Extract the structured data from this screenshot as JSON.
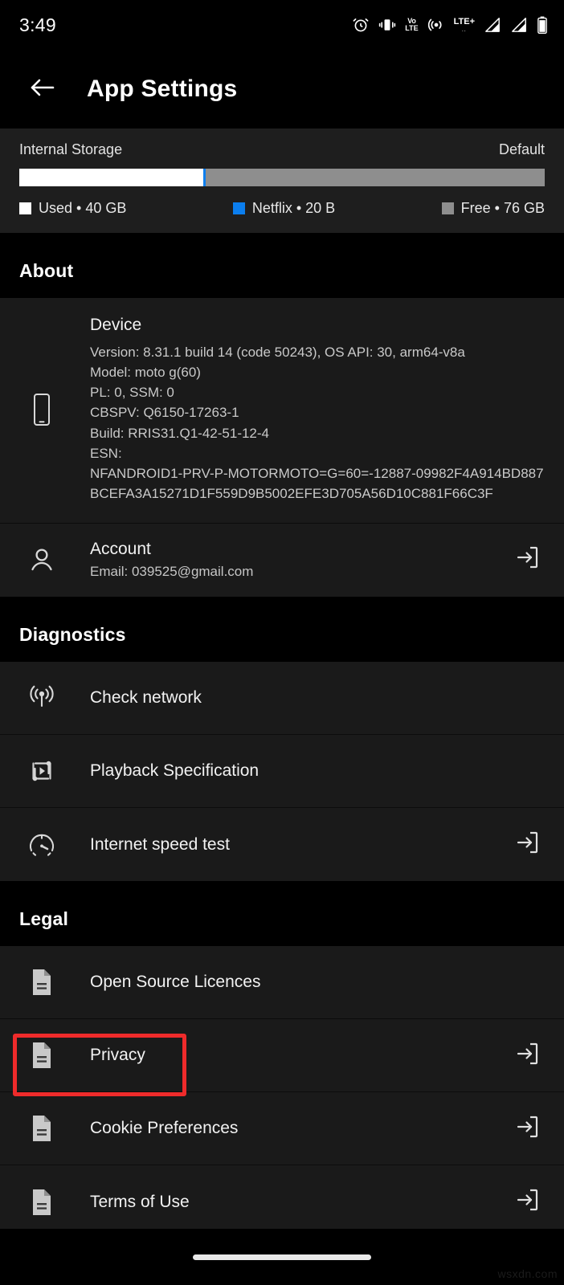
{
  "status_bar": {
    "time": "3:49",
    "icons": [
      "alarm-icon",
      "vibrate-icon",
      "volte-icon",
      "hotspot-icon",
      "lte-plus-icon",
      "signal-1-icon",
      "signal-2-icon",
      "battery-icon"
    ],
    "volte_top": "Vo",
    "volte_bottom": "LTE",
    "lte_label": "LTE+",
    "lte_dots": ".."
  },
  "app_bar": {
    "back_icon": "arrow-left-icon",
    "title": "App Settings"
  },
  "storage": {
    "label": "Internal Storage",
    "mode": "Default",
    "used_pct": 35,
    "netflix_pct": 0.4,
    "free_pct": 64.6,
    "colors": {
      "used": "#ffffff",
      "netflix": "#0b7eee",
      "free": "#8e8e8e"
    },
    "legend": [
      {
        "label": "Used • 40 GB",
        "color": "#ffffff"
      },
      {
        "label": "Netflix • 20 B",
        "color": "#0b7eee"
      },
      {
        "label": "Free • 76 GB",
        "color": "#8e8e8e"
      }
    ]
  },
  "about": {
    "header": "About",
    "device": {
      "icon": "smartphone-icon",
      "title": "Device",
      "lines": [
        "Version: 8.31.1 build 14 (code 50243), OS API: 30, arm64-v8a",
        "Model: moto g(60)",
        "PL: 0, SSM: 0",
        "CBSPV: Q6150-17263-1",
        "Build: RRIS31.Q1-42-51-12-4",
        "ESN:",
        "NFANDROID1-PRV-P-MOTORMOTO=G=60=-12887-09982F4A914BD887BCEFA3A15271D1F559D9B5002EFE3D705A56D10C881F66C3F"
      ]
    },
    "account": {
      "icon": "person-icon",
      "title": "Account",
      "subtitle": "Email: 039525@gmail.com",
      "action_icon": "open-external-icon"
    }
  },
  "diagnostics": {
    "header": "Diagnostics",
    "items": [
      {
        "icon": "broadcast-icon",
        "label": "Check network",
        "action": ""
      },
      {
        "icon": "playback-spec-icon",
        "label": "Playback Specification",
        "action": ""
      },
      {
        "icon": "speedometer-icon",
        "label": "Internet speed test",
        "action": "open-external-icon"
      }
    ]
  },
  "legal": {
    "header": "Legal",
    "items": [
      {
        "icon": "document-icon",
        "label": "Open Source Licences",
        "action": ""
      },
      {
        "icon": "document-icon",
        "label": "Privacy",
        "action": "open-external-icon",
        "highlighted": true
      },
      {
        "icon": "document-icon",
        "label": "Cookie Preferences",
        "action": "open-external-icon"
      },
      {
        "icon": "document-icon",
        "label": "Terms of Use",
        "action": "open-external-icon"
      }
    ]
  },
  "highlight": {
    "color": "#ef2b2b",
    "target": "Privacy"
  },
  "nav_bar": {
    "pill": "home-gesture-pill"
  },
  "watermark": "wsxdn.com"
}
